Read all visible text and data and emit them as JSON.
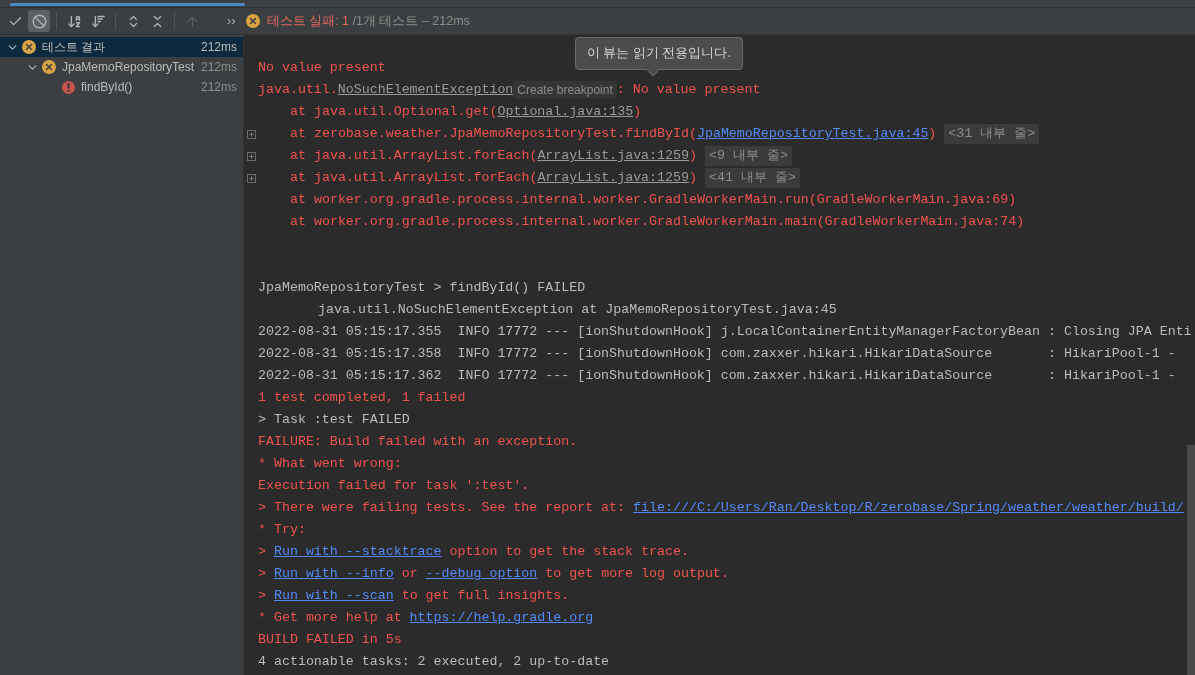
{
  "toolbar": {
    "buttons": [
      {
        "kind": "check",
        "selected": false,
        "disabled": false
      },
      {
        "kind": "stop",
        "selected": true,
        "disabled": false
      },
      {
        "kind": "sort-alpha",
        "selected": false,
        "disabled": false
      },
      {
        "kind": "sort-duration",
        "selected": false,
        "disabled": false
      },
      {
        "kind": "expand-all",
        "selected": false,
        "disabled": false
      },
      {
        "kind": "collapse-all",
        "selected": false,
        "disabled": false
      },
      {
        "kind": "up",
        "selected": false,
        "disabled": true
      }
    ],
    "more": "››",
    "status": {
      "failed": "테스트 실패: 1",
      "rest": " /1개 테스트 – 212ms"
    }
  },
  "tree": [
    {
      "label": "테스트 결과",
      "time": "212ms",
      "kind": "suite",
      "expanded": true,
      "selected": true,
      "children": [
        {
          "label": "JpaMemoRepositoryTest",
          "time": "212ms",
          "kind": "suite",
          "expanded": true,
          "selected": false,
          "children": [
            {
              "label": "findById()",
              "time": "212ms",
              "kind": "test",
              "selected": false
            }
          ]
        }
      ]
    }
  ],
  "tooltip": "이 뷰는 읽기 전용입니다.",
  "console": [
    {
      "kind": "plain",
      "expandable": false,
      "segments": [
        {
          "kind": "error",
          "text": "No value present"
        }
      ]
    },
    {
      "kind": "plain",
      "expandable": false,
      "segments": [
        {
          "kind": "error",
          "text": "java.util."
        },
        {
          "kind": "file",
          "text": "NoSuchElementException"
        },
        {
          "kind": "hint",
          "text": "Create breakpoint"
        },
        {
          "kind": "error",
          "text": ": No value present"
        }
      ]
    },
    {
      "kind": "frame",
      "expandable": false,
      "segments": [
        {
          "kind": "error",
          "text": "at java.util.Optional.get("
        },
        {
          "kind": "file",
          "text": "Optional.java:135"
        },
        {
          "kind": "error",
          "text": ")"
        }
      ]
    },
    {
      "kind": "frame",
      "expandable": true,
      "segments": [
        {
          "kind": "error",
          "text": "at zerobase.weather.JpaMemoRepositoryTest.findById("
        },
        {
          "kind": "link",
          "text": "JpaMemoRepositoryTest.java:45"
        },
        {
          "kind": "error",
          "text": ")"
        },
        {
          "kind": "folded",
          "text": "<31 내부 줄>"
        }
      ]
    },
    {
      "kind": "frame",
      "expandable": true,
      "segments": [
        {
          "kind": "error",
          "text": "at java.util.ArrayList.forEach("
        },
        {
          "kind": "file",
          "text": "ArrayList.java:1259"
        },
        {
          "kind": "error",
          "text": ")"
        },
        {
          "kind": "folded",
          "text": "<9 내부 줄>"
        }
      ]
    },
    {
      "kind": "frame",
      "expandable": true,
      "segments": [
        {
          "kind": "error",
          "text": "at java.util.ArrayList.forEach("
        },
        {
          "kind": "file",
          "text": "ArrayList.java:1259"
        },
        {
          "kind": "error",
          "text": ")"
        },
        {
          "kind": "folded",
          "text": "<41 내부 줄>"
        }
      ]
    },
    {
      "kind": "frame",
      "expandable": false,
      "segments": [
        {
          "kind": "error",
          "text": "at worker.org.gradle.process.internal.worker.GradleWorkerMain.run(GradleWorkerMain.java:69)"
        }
      ]
    },
    {
      "kind": "frame",
      "expandable": false,
      "segments": [
        {
          "kind": "error",
          "text": "at worker.org.gradle.process.internal.worker.GradleWorkerMain.main(GradleWorkerMain.java:74)"
        }
      ]
    },
    {
      "kind": "blank",
      "expandable": false
    },
    {
      "kind": "blank",
      "expandable": false
    },
    {
      "kind": "plain",
      "expandable": false,
      "segments": [
        {
          "kind": "plain",
          "text": "JpaMemoRepositoryTest > findById() FAILED"
        }
      ]
    },
    {
      "kind": "cause",
      "expandable": false,
      "segments": [
        {
          "kind": "plain",
          "text": "java.util.NoSuchElementException at JpaMemoRepositoryTest.java:45"
        }
      ]
    },
    {
      "kind": "plain",
      "expandable": false,
      "segments": [
        {
          "kind": "plain",
          "text": "2022-08-31 05:15:17.355  INFO 17772 --- [ionShutdownHook] j.LocalContainerEntityManagerFactoryBean : Closing JPA Enti"
        }
      ]
    },
    {
      "kind": "plain",
      "expandable": false,
      "segments": [
        {
          "kind": "plain",
          "text": "2022-08-31 05:15:17.358  INFO 17772 --- [ionShutdownHook] com.zaxxer.hikari.HikariDataSource       : HikariPool-1 -"
        }
      ]
    },
    {
      "kind": "plain",
      "expandable": false,
      "segments": [
        {
          "kind": "plain",
          "text": "2022-08-31 05:15:17.362  INFO 17772 --- [ionShutdownHook] com.zaxxer.hikari.HikariDataSource       : HikariPool-1 -"
        }
      ]
    },
    {
      "kind": "plain",
      "expandable": false,
      "segments": [
        {
          "kind": "error",
          "text": "1 test completed, 1 failed"
        }
      ]
    },
    {
      "kind": "plain",
      "expandable": false,
      "segments": [
        {
          "kind": "plain",
          "text": "> Task :test FAILED"
        }
      ]
    },
    {
      "kind": "plain",
      "expandable": false,
      "segments": [
        {
          "kind": "error",
          "text": "FAILURE: Build failed with an exception."
        }
      ]
    },
    {
      "kind": "plain",
      "expandable": false,
      "segments": [
        {
          "kind": "error",
          "text": "* What went wrong:"
        }
      ]
    },
    {
      "kind": "plain",
      "expandable": false,
      "segments": [
        {
          "kind": "error",
          "text": "Execution failed for task ':test'."
        }
      ]
    },
    {
      "kind": "plain",
      "expandable": false,
      "segments": [
        {
          "kind": "error",
          "text": "> There were failing tests. See the report at: "
        },
        {
          "kind": "link",
          "text": "file:///C:/Users/Ran/Desktop/R/zerobase/Spring/weather/weather/build/"
        }
      ]
    },
    {
      "kind": "plain",
      "expandable": false,
      "segments": [
        {
          "kind": "error",
          "text": "* Try:"
        }
      ]
    },
    {
      "kind": "plain",
      "expandable": false,
      "segments": [
        {
          "kind": "error",
          "text": "> "
        },
        {
          "kind": "link",
          "text": "Run with --stacktrace"
        },
        {
          "kind": "error",
          "text": " option to get the stack trace."
        }
      ]
    },
    {
      "kind": "plain",
      "expandable": false,
      "segments": [
        {
          "kind": "error",
          "text": "> "
        },
        {
          "kind": "link",
          "text": "Run with --info"
        },
        {
          "kind": "error",
          "text": " or "
        },
        {
          "kind": "link",
          "text": "--debug option"
        },
        {
          "kind": "error",
          "text": " to get more log output."
        }
      ]
    },
    {
      "kind": "plain",
      "expandable": false,
      "segments": [
        {
          "kind": "error",
          "text": "> "
        },
        {
          "kind": "link",
          "text": "Run with --scan"
        },
        {
          "kind": "error",
          "text": " to get full insights."
        }
      ]
    },
    {
      "kind": "plain",
      "expandable": false,
      "segments": [
        {
          "kind": "error",
          "text": "* Get more help at "
        },
        {
          "kind": "link",
          "text": "https://help.gradle.org"
        }
      ]
    },
    {
      "kind": "plain",
      "expandable": false,
      "segments": [
        {
          "kind": "error",
          "text": "BUILD FAILED in 5s"
        }
      ]
    },
    {
      "kind": "plain",
      "expandable": false,
      "segments": [
        {
          "kind": "plain",
          "text": "4 actionable tasks: 2 executed, 2 up-to-date"
        }
      ]
    }
  ]
}
